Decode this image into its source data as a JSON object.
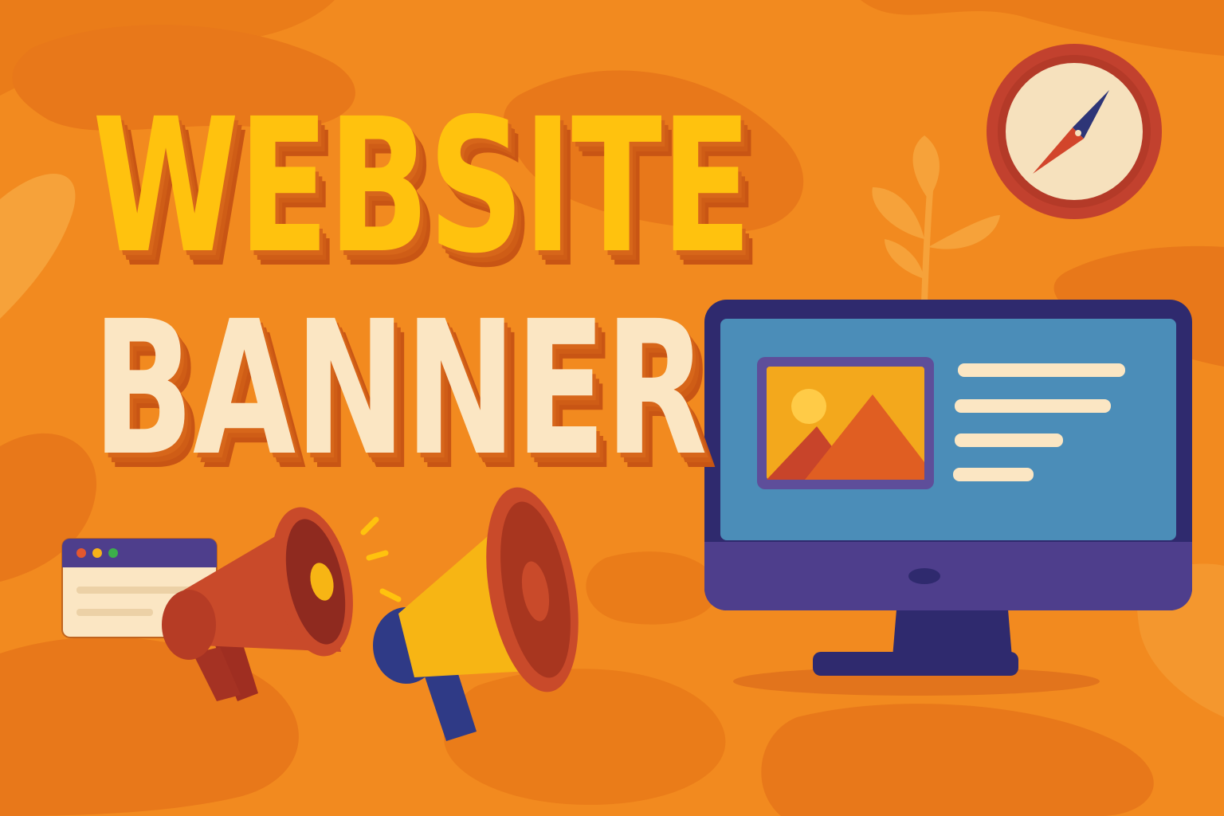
{
  "banner": {
    "title_line1": "WEBSITE",
    "title_line2": "BANNER"
  },
  "colors": {
    "background": "#f28a1f",
    "title_line1": "#ffc20e",
    "title_line2": "#fbe6c3",
    "monitor_frame": "#2f2a6e",
    "monitor_screen": "#4b8db8",
    "megaphone_red": "#c94a2a",
    "megaphone_yellow": "#f7b514",
    "compass_ring": "#c2412e"
  },
  "icons": [
    "compass-icon",
    "leaf-plant-icon",
    "monitor-icon",
    "image-placeholder-icon",
    "browser-window-icon",
    "megaphone-icon"
  ]
}
